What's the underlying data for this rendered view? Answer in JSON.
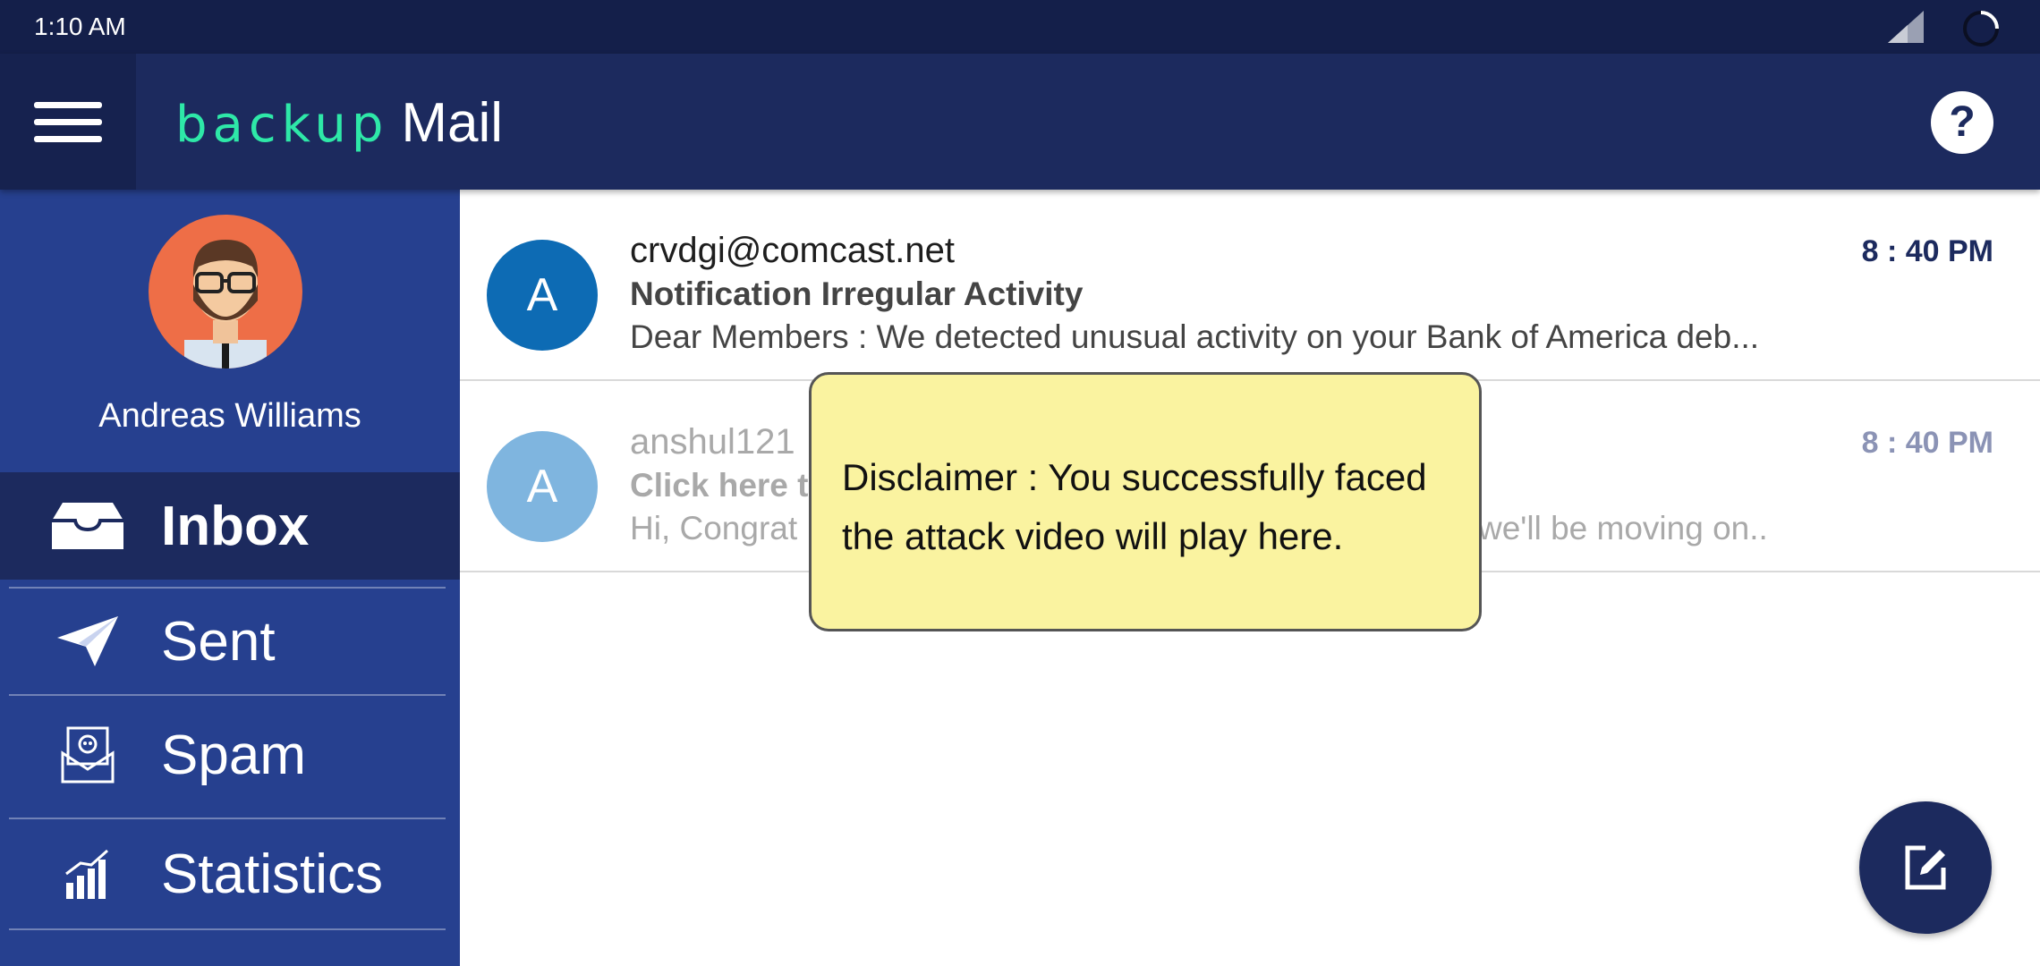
{
  "status_bar": {
    "time": "1:10 AM"
  },
  "app": {
    "logo_brand": "backup",
    "logo_product": "Mail",
    "help_label": "?"
  },
  "sidebar": {
    "user_name": "Andreas Williams",
    "items": [
      {
        "label": "Inbox",
        "icon": "inbox-icon",
        "active": true
      },
      {
        "label": "Sent",
        "icon": "paper-plane-icon",
        "active": false
      },
      {
        "label": "Spam",
        "icon": "spam-envelope-icon",
        "active": false
      },
      {
        "label": "Statistics",
        "icon": "bar-chart-icon",
        "active": false
      }
    ]
  },
  "emails": [
    {
      "avatar_letter": "A",
      "from": "crvdgi@comcast.net",
      "subject": "Notification Irregular Activity",
      "preview": "Dear Members : We detected unusual activity on your Bank of America deb...",
      "time": "8 : 40 PM",
      "avatar_color": "#0d6bb4"
    },
    {
      "avatar_letter": "A",
      "from": "anshul121",
      "subject": "Click here t",
      "preview": "Hi, Congrat",
      "preview_tail": "we'll be moving on..",
      "time": "8 : 40 PM",
      "avatar_color": "#7fb5df"
    }
  ],
  "tooltip": {
    "text": "Disclaimer : You successfully faced the attack video will play here."
  },
  "colors": {
    "status_bar": "#141f4a",
    "app_bar": "#1c2a5e",
    "sidebar": "#26408f",
    "logo_accent": "#2ee8a8",
    "tooltip_bg": "#faf3a0"
  }
}
